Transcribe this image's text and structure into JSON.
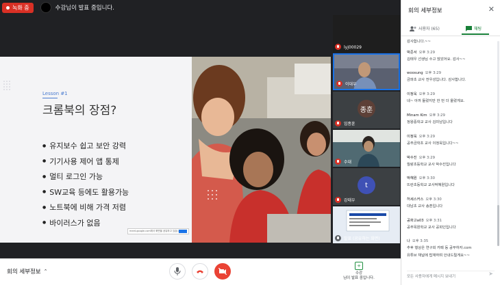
{
  "topbar": {
    "recording_label": "녹화 중",
    "presenter_text": "수강님이 발표 중입니다."
  },
  "slide": {
    "lesson": "Lesson #1",
    "title": "크롬북의 장점?",
    "bullets": [
      "유지보수 쉽고 보안 강력",
      "기기사용 제어 앱 통제",
      "멀티 로그인 가능",
      "SW교육 등에도 활용가능",
      "노트북에 비해 가격 저렴",
      "바이러스가 없음"
    ],
    "share_bar_text": "meet.google.com에서 화면을 공유하고 있습니다."
  },
  "tiles": [
    {
      "name": "lyj00029",
      "kind": "video",
      "color": "#2b2b2b"
    },
    {
      "name": "이대우",
      "kind": "video",
      "color": "#4a5060"
    },
    {
      "name": "임종훈",
      "kind": "avatar",
      "initial": "종훈",
      "color": "#5d4037"
    },
    {
      "name": "수대",
      "kind": "video",
      "color": "#3a5a6a"
    },
    {
      "name": "강태우",
      "kind": "avatar",
      "initial": "t",
      "color": "#3f51b5"
    },
    {
      "name": "발표 (공유하는 화면)",
      "kind": "screen",
      "color": "#d0d8e8"
    }
  ],
  "bottombar": {
    "meeting_title": "회의 세부정보",
    "presenting_line1": "수강",
    "presenting_line2": "님이 발표 중입니다."
  },
  "panel": {
    "title": "회의 세부정보",
    "tab_people": "사용자 (65)",
    "tab_chat": "채팅",
    "messages": [
      {
        "name": "",
        "time": "",
        "text": "감사합니다.~~"
      },
      {
        "name": "박준서",
        "time": "오후 3:29",
        "text": "김태우 선생님 수고 많았어요. 감사~~"
      },
      {
        "name": "woosung",
        "time": "오후 3:29",
        "text": "금파초 교사 전우성입니다. 감사합니다."
      },
      {
        "name": "이정욱",
        "time": "오후 3:29",
        "text": "네~ 아까 들렸지만 한 번 더 올렸게요."
      },
      {
        "name": "Minam Kim",
        "time": "오후 3:29",
        "text": "정왕중학교 교사 김미남입니다"
      },
      {
        "name": "이정욱",
        "time": "오후 3:29",
        "text": "공주금학초 교사 이정욱입니다~~"
      },
      {
        "name": "박수진",
        "time": "오후 3:29",
        "text": "월랑초등학교 교사 박수진입니다"
      },
      {
        "name": "박혜원",
        "time": "오후 3:30",
        "text": "뜨란초등학교 교사박혜원입니다"
      },
      {
        "name": "허세스커스",
        "time": "오후 3:30",
        "text": "대남초 교사 송훈입니다"
      },
      {
        "name": "공화고a03",
        "time": "오후 3:31",
        "text": "공주목원학교 교사 공회인입니다"
      },
      {
        "name": "나",
        "time": "오후 3:35",
        "text": "추후 행상은 연구회 카페 등 공부하자.com"
      },
      {
        "name": "",
        "time": "",
        "text": "유튜브 채널에 탑재하며 안내드릴게요~~"
      }
    ],
    "input_placeholder": "모든 사용자에게 메시지 보내기"
  }
}
